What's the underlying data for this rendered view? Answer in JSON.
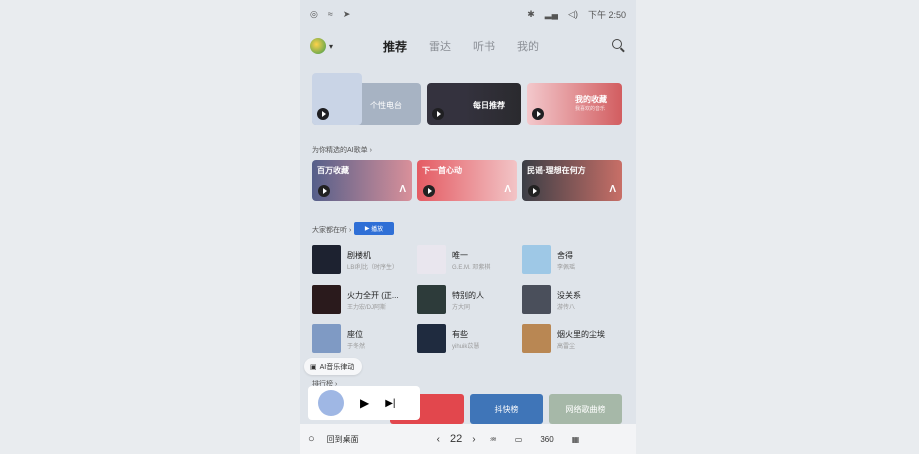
{
  "status": {
    "time": "下午 2:50"
  },
  "header": {
    "tabs": [
      "推荐",
      "雷达",
      "听书",
      "我的"
    ]
  },
  "featured": [
    {
      "label": "个性电台"
    },
    {
      "label": "每日推荐"
    },
    {
      "label": "我的收藏",
      "sub": "我喜欢的音乐"
    }
  ],
  "ai_section": {
    "title": "为你精选的AI歌单",
    "cards": [
      "百万收藏",
      "下一首心动",
      "民谣·理想在何方"
    ]
  },
  "hot_section": {
    "title": "大家都在听",
    "play_label": "播放"
  },
  "songs": [
    {
      "title": "剧楼机",
      "sub": "LBI利比（时序生）"
    },
    {
      "title": "唯一",
      "sub": "G.E.M. 邓紫棋"
    },
    {
      "title": "舍得",
      "sub": "李佩瑶"
    },
    {
      "title": "火力全开 (正...",
      "sub": "王力宏/DJ阿斯"
    },
    {
      "title": "特别的人",
      "sub": "方大同"
    },
    {
      "title": "没关系",
      "sub": "游传八"
    },
    {
      "title": "座位",
      "sub": "于冬然"
    },
    {
      "title": "有些",
      "sub": "yihuik苡慧"
    },
    {
      "title": "烟火里的尘埃",
      "sub": "高雷尘"
    }
  ],
  "ai_pill": "AI音乐律动",
  "rank_section": {
    "title": "排行榜",
    "items": [
      "抖快榜",
      "网络歌曲榜"
    ]
  },
  "bottom": {
    "home": "回到桌面",
    "temp": "22",
    "fan": "360"
  }
}
